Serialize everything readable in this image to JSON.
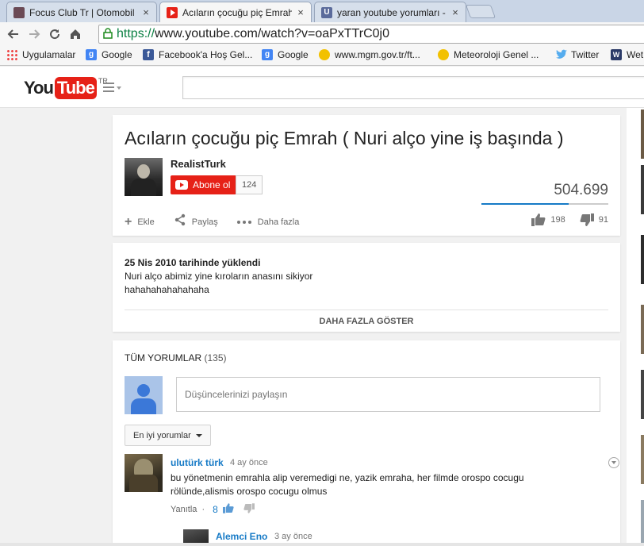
{
  "browser": {
    "tabs": [
      {
        "title": "Focus Club Tr | Otomobil ",
        "favicon": "car-forum-icon",
        "active": false
      },
      {
        "title": "Acıların çocuğu piç Emrah",
        "favicon": "youtube-icon",
        "active": true
      },
      {
        "title": "yaran youtube yorumları - ",
        "favicon": "u-site-icon",
        "active": false
      }
    ],
    "close_glyph": "×",
    "url_scheme": "https://",
    "url_rest": "www.youtube.com/watch?v=oaPxTTrC0j0",
    "bookmarks": [
      {
        "label": "Uygulamalar",
        "icon": "apps-grid-icon"
      },
      {
        "label": "Google",
        "icon": "google-icon"
      },
      {
        "label": "Facebook'a Hoş Gel...",
        "icon": "facebook-icon"
      },
      {
        "label": "Google",
        "icon": "google-icon"
      },
      {
        "label": "www.mgm.gov.tr/ft...",
        "icon": "mgm-icon"
      },
      {
        "label": "Meteoroloji Genel ...",
        "icon": "mgm-icon"
      },
      {
        "label": "Twitter",
        "icon": "twitter-icon"
      },
      {
        "label": "Wet",
        "icon": "w-icon"
      }
    ]
  },
  "youtube": {
    "logo_you": "You",
    "logo_tube": "Tube",
    "logo_region": "TR"
  },
  "video": {
    "title": "Acıların çocuğu piç Emrah ( Nuri alço yine iş başında )",
    "channel": "RealistTurk",
    "subscribe_label": "Abone ol",
    "subscriber_count": "124",
    "views": "504.699",
    "like_ratio": 0.685,
    "actions": {
      "add": "Ekle",
      "share": "Paylaş",
      "more": "Daha fazla"
    },
    "likes": "198",
    "dislikes": "91"
  },
  "description": {
    "date": "25 Nis 2010 tarihinde yüklendi",
    "lines": [
      "Nuri alço abimiz yine kıroların anasını sikiyor",
      "hahahahahahahaha"
    ],
    "show_more": "DAHA FAZLA GÖSTER"
  },
  "comments": {
    "header": "TÜM YORUMLAR",
    "count": "(135)",
    "placeholder": "Düşüncelerinizi paylaşın",
    "sort_label": "En iyi yorumlar",
    "items": [
      {
        "author": "ulutürk türk",
        "time": "4 ay önce",
        "text": "bu yönetmenin emrahla alip veremedigi ne, yazik emraha, her filmde orospo cocugu rölünde,alismis orospo cocugu olmus",
        "reply_label": "Yanıtla",
        "separator": "·",
        "likes": "8"
      }
    ],
    "reply": {
      "author": "Alemci Eno",
      "time": "3 ay önce"
    }
  }
}
